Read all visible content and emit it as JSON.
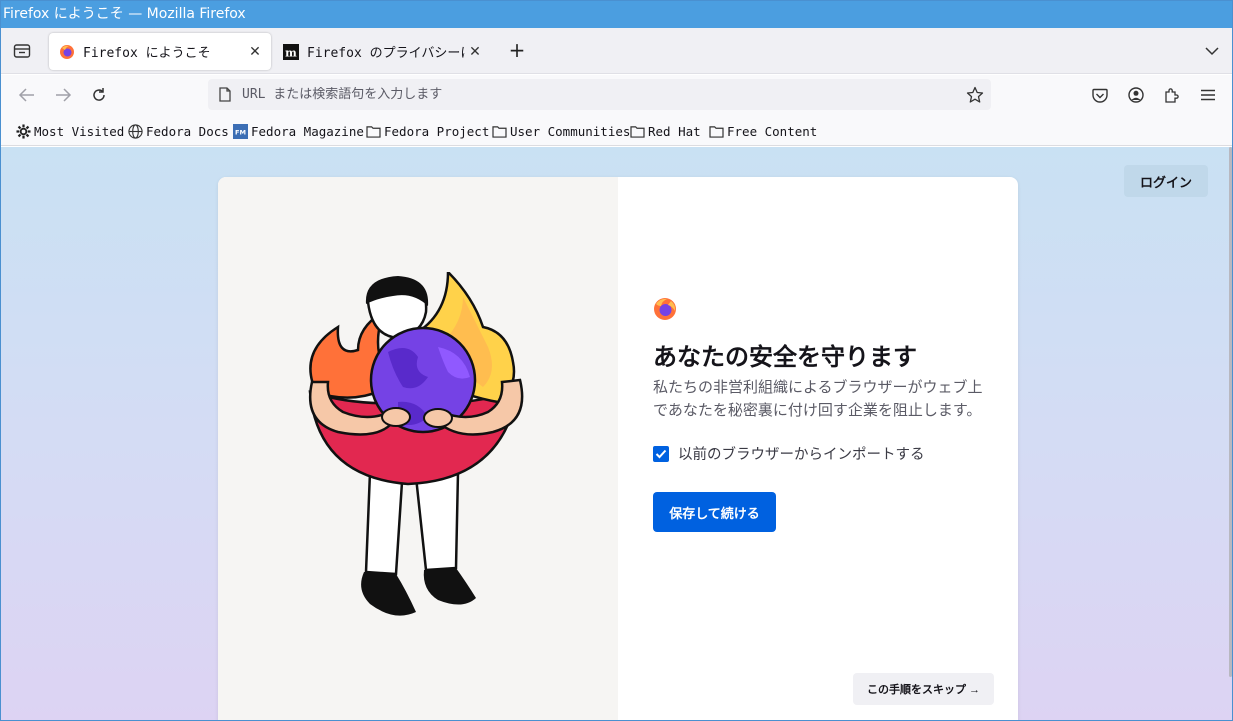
{
  "window": {
    "title": "Firefox にようこそ — Mozilla Firefox"
  },
  "tabs": [
    {
      "title": "Firefox にようこそ",
      "active": true
    },
    {
      "title": "Firefox のプライバシーに関"
    }
  ],
  "tab_close_symbol": "✕",
  "new_tab_symbol": "+",
  "urlbar": {
    "placeholder": "URL または検索語句を入力します",
    "value": ""
  },
  "bookmarks": [
    {
      "label": "Most Visited",
      "icon": "gear-icon"
    },
    {
      "label": "Fedora Docs",
      "icon": "globe-icon"
    },
    {
      "label": "Fedora Magazine",
      "icon": "fm-icon"
    },
    {
      "label": "Fedora Project",
      "icon": "folder-icon"
    },
    {
      "label": "User Communities",
      "icon": "folder-icon"
    },
    {
      "label": "Red Hat",
      "icon": "folder-icon"
    },
    {
      "label": "Free Content",
      "icon": "folder-icon"
    }
  ],
  "page": {
    "login_label": "ログイン",
    "heading": "あなたの安全を守ります",
    "subtext": "私たちの非営利組織によるブラウザーがウェブ上であなたを秘密裏に付け回す企業を阻止します。",
    "import_checkbox_label": "以前のブラウザーからインポートする",
    "import_checked": true,
    "primary_button": "保存して続ける",
    "skip_button": "この手順をスキップ →"
  },
  "colors": {
    "titlebar": "#4b9ee0",
    "accent": "#0061e0",
    "gradient_top": "#c9e1f3",
    "gradient_bottom": "#ddd3f3"
  }
}
